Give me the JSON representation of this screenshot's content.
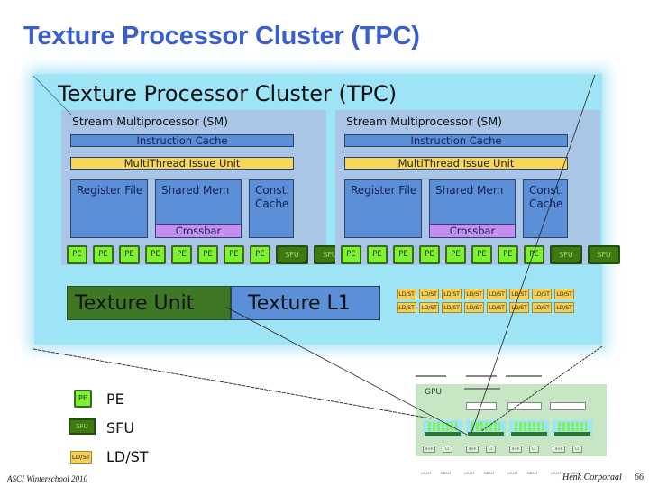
{
  "slide": {
    "title": "Texture Processor Cluster (TPC)",
    "footer_left": "ASCI Winterschool 2010",
    "footer_right": "Henk Corporaal",
    "page_number": "66"
  },
  "tpc": {
    "title": "Texture Processor Cluster (TPC)",
    "sms": [
      {
        "title": "Stream Multiprocessor (SM)",
        "instruction_cache": "Instruction Cache",
        "issue_unit": "MultiThread Issue Unit",
        "register_file": "Register File",
        "shared_mem": "Shared Mem",
        "crossbar": "Crossbar",
        "const_cache": "Const. Cache",
        "pe_units": [
          "PE",
          "PE",
          "PE",
          "PE",
          "PE",
          "PE",
          "PE",
          "PE"
        ],
        "sfu_units": [
          "SFU",
          "SFU"
        ]
      },
      {
        "title": "Stream Multiprocessor (SM)",
        "instruction_cache": "Instruction Cache",
        "issue_unit": "MultiThread Issue Unit",
        "register_file": "Register File",
        "shared_mem": "Shared Mem",
        "crossbar": "Crossbar",
        "const_cache": "Const. Cache",
        "pe_units": [
          "PE",
          "PE",
          "PE",
          "PE",
          "PE",
          "PE",
          "PE",
          "PE"
        ],
        "sfu_units": [
          "SFU",
          "SFU"
        ]
      }
    ],
    "texture_unit": "Texture Unit",
    "texture_l1": "Texture L1",
    "ldst_units": [
      "LD/ST",
      "LD/ST",
      "LD/ST",
      "LD/ST",
      "LD/ST",
      "LD/ST",
      "LD/ST",
      "LD/ST",
      "LD/ST",
      "LD/ST",
      "LD/ST",
      "LD/ST",
      "LD/ST",
      "LD/ST",
      "LD/ST",
      "LD/ST"
    ]
  },
  "legend": [
    {
      "glyph": "PE",
      "label": "PE"
    },
    {
      "glyph": "SFU",
      "label": "SFU"
    },
    {
      "glyph": "LD/ST",
      "label": "LD/ST"
    }
  ],
  "gpu_thumbnail": {
    "label": "GPU",
    "memory_partitions": [
      "ROP",
      "L2",
      "ROP",
      "L2",
      "ROP",
      "L2",
      "ROP",
      "L2"
    ],
    "dram": [
      "DRAM",
      "DRAM",
      "DRAM",
      "DRAM",
      "DRAM",
      "DRAM",
      "DRAM",
      "DRAM"
    ]
  },
  "colors": {
    "title_blue": "#3a5fcd",
    "tpc_bg": "#9ee4f7",
    "sm_bg": "#aac6e6",
    "block_blue": "#5b8fd8",
    "issue_yellow": "#f8d65a",
    "crossbar_purple": "#c58ef0",
    "pe_green": "#7ef22e",
    "sfu_green": "#3d7b12",
    "texture_unit_green": "#3f7824",
    "ldst_yellow": "#f4d05a"
  }
}
